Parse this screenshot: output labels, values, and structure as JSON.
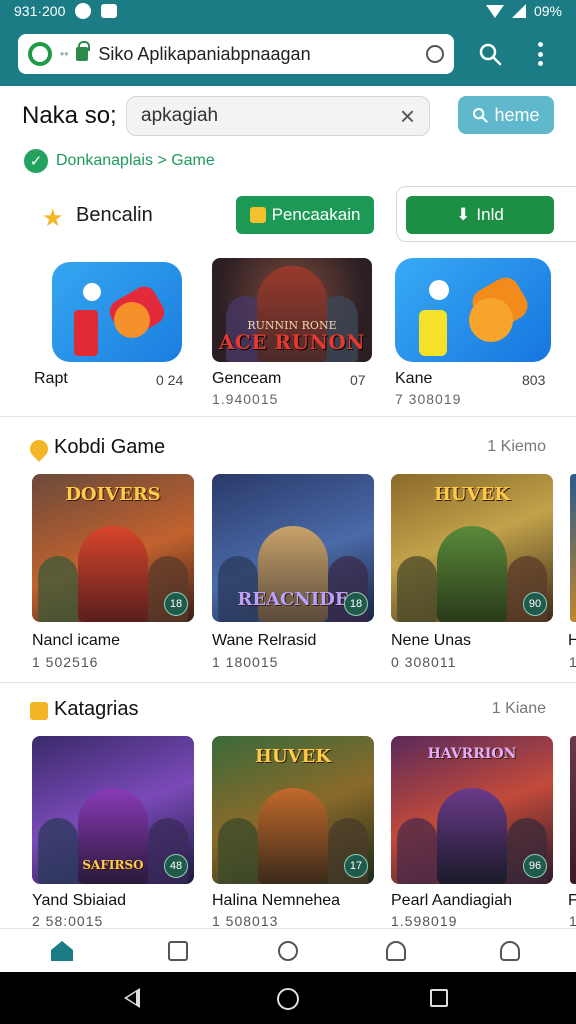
{
  "status_bar": {
    "time": "931·200",
    "battery": "09%"
  },
  "browser": {
    "url": "Siko Aplikapaniabpnaagan"
  },
  "search": {
    "page_title": "Naka so;",
    "query": "apkagiah",
    "home_button": "heme"
  },
  "breadcrumb": "Donkanaplais > Game",
  "featured": {
    "title": "Bencalin",
    "primary_button": "Pencaakain",
    "secondary_button": "Inld",
    "apps": [
      {
        "name": "Rapt",
        "num": "0 24",
        "sub": ""
      },
      {
        "name": "Genceam",
        "num": "07",
        "sub": "1.940015",
        "art_title": "ACE RUNON",
        "art_subtitle": "RUNNIN RONE"
      },
      {
        "name": "Kane",
        "num": "803",
        "sub": "7 308019"
      }
    ]
  },
  "section_games": {
    "title": "Kobdi Game",
    "link": "1 Kiemo",
    "cards": [
      {
        "name": "Nancl icame",
        "sub": "1 502516",
        "art_title": "DOIVERS",
        "badge": "18"
      },
      {
        "name": "Wane Relrasid",
        "sub": "1 180015",
        "art_title": "REACNIDE",
        "badge": "18"
      },
      {
        "name": "Nene Unas",
        "sub": "0 308011",
        "art_title": "HUVEK",
        "badge": "90"
      }
    ],
    "peek_name": "H",
    "peek_sub": "1"
  },
  "section_categories": {
    "title": "Katagrias",
    "link": "1 Kiane",
    "cards": [
      {
        "name": "Yand Sbiaiad",
        "sub": "2 58:0015",
        "art_title": "SAFIRSO",
        "badge": "48"
      },
      {
        "name": "Halina Nemnehea",
        "sub": "1 508013",
        "art_title": "HUVEK",
        "badge": "17"
      },
      {
        "name": "Pearl Aandiagiah",
        "sub": "1.598019",
        "art_title": "HAVRRION",
        "badge": "96"
      }
    ],
    "peek_name": "F",
    "peek_sub": "1"
  },
  "bottom_nav": [
    "home-icon",
    "library-icon",
    "search-icon",
    "notifications-icon",
    "profile-icon"
  ],
  "colors": {
    "brand": "#1b7c86",
    "accent_green": "#1c9a55",
    "home_button": "#5fb8cc",
    "star": "#f4b526"
  }
}
